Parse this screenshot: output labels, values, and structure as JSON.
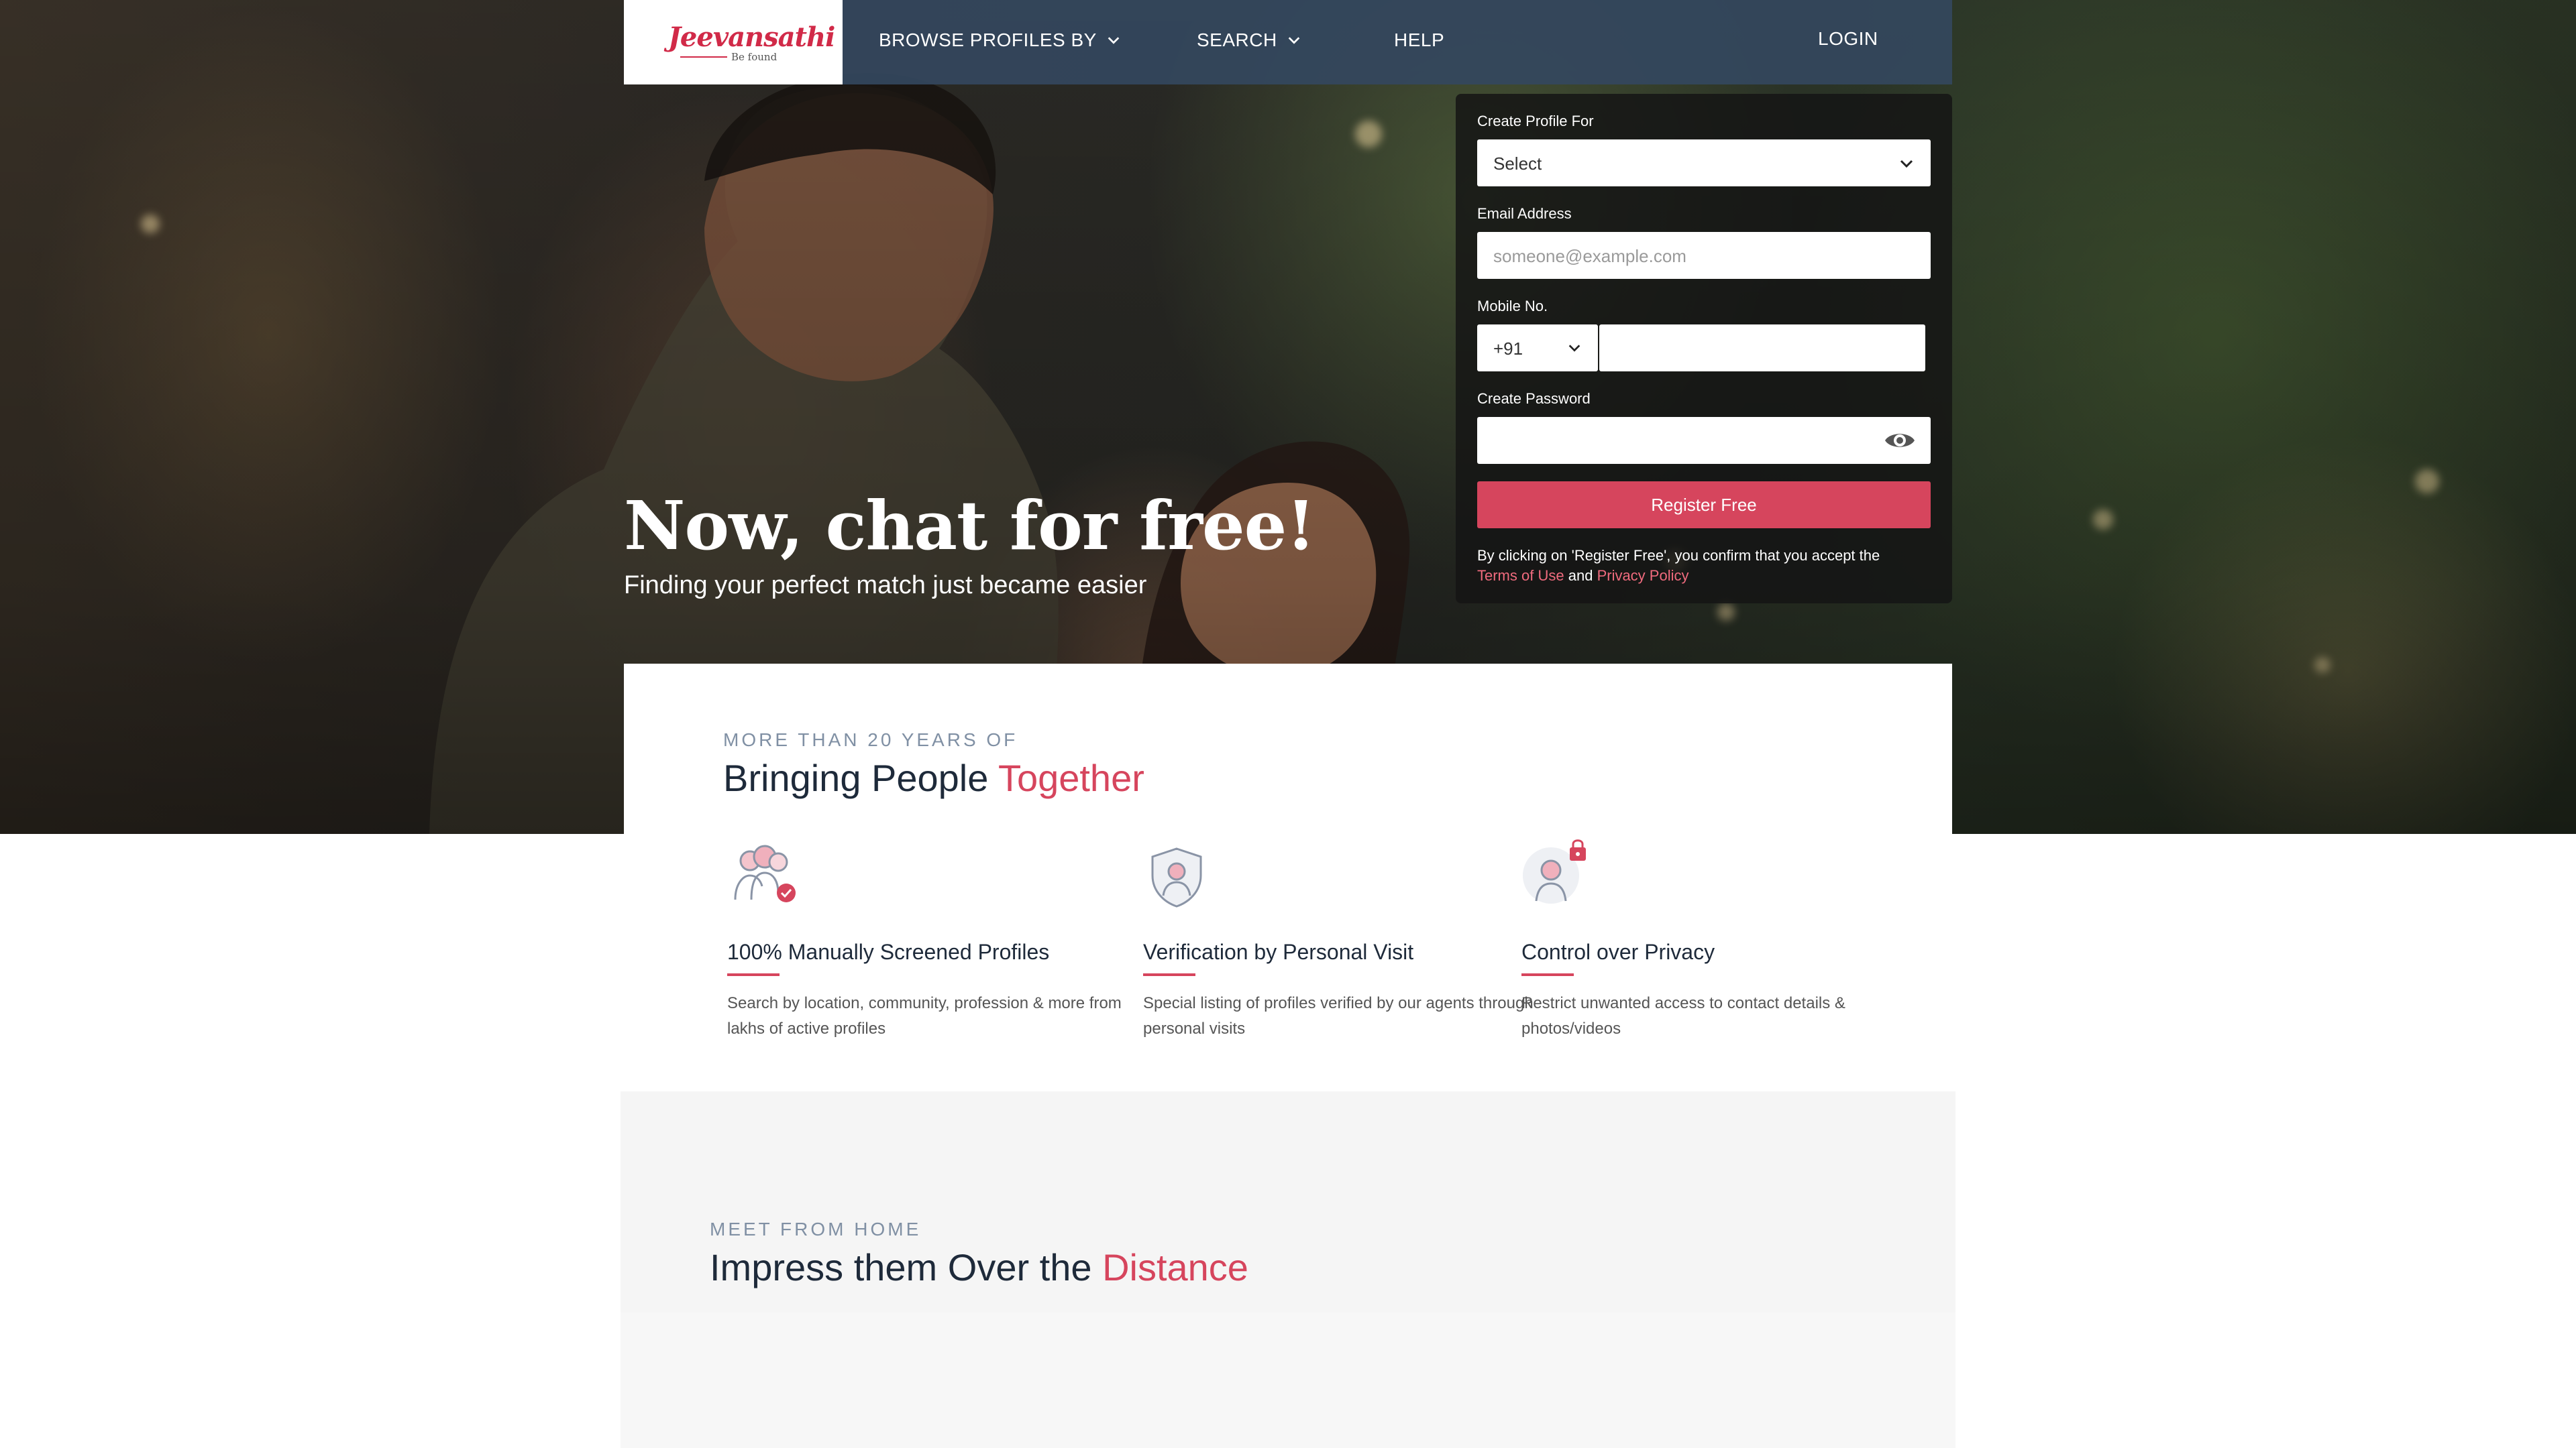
{
  "nav": {
    "logo_text": "Jeevansathi",
    "logo_tagline": "Be found",
    "browse_label": "BROWSE PROFILES BY",
    "search_label": "SEARCH",
    "help_label": "HELP",
    "login_label": "LOGIN"
  },
  "hero": {
    "title": "Now, chat for free!",
    "subtitle": "Finding your perfect match just became easier"
  },
  "form": {
    "profile_for_label": "Create Profile For",
    "profile_for_value": "Select",
    "email_label": "Email Address",
    "email_placeholder": "someone@example.com",
    "mobile_label": "Mobile No.",
    "country_code": "+91",
    "password_label": "Create Password",
    "register_label": "Register Free",
    "terms_prefix": "By clicking on 'Register Free', you confirm that you accept the",
    "terms_link": "Terms of Use",
    "terms_and": "and",
    "privacy_link": "Privacy Policy"
  },
  "features_section": {
    "eyebrow": "MORE THAN 20 YEARS OF",
    "heading_main": "Bringing People",
    "heading_accent": "Together",
    "items": [
      {
        "icon": "screened-profiles-icon",
        "title": "100% Manually Screened Profiles",
        "description": "Search by location, community, profession & more from lakhs of active profiles"
      },
      {
        "icon": "verified-shield-icon",
        "title": "Verification by Personal Visit",
        "description": "Special listing of profiles verified by our agents through personal visits"
      },
      {
        "icon": "privacy-lock-icon",
        "title": "Control over Privacy",
        "description": "Restrict unwanted access to contact details & photos/videos"
      }
    ]
  },
  "meet_section": {
    "eyebrow": "MEET FROM HOME",
    "heading_main": "Impress them Over the",
    "heading_accent": "Distance"
  },
  "colors": {
    "accent": "#d6455d",
    "nav_bg": "#34475e",
    "heading": "#1e2a3a"
  }
}
